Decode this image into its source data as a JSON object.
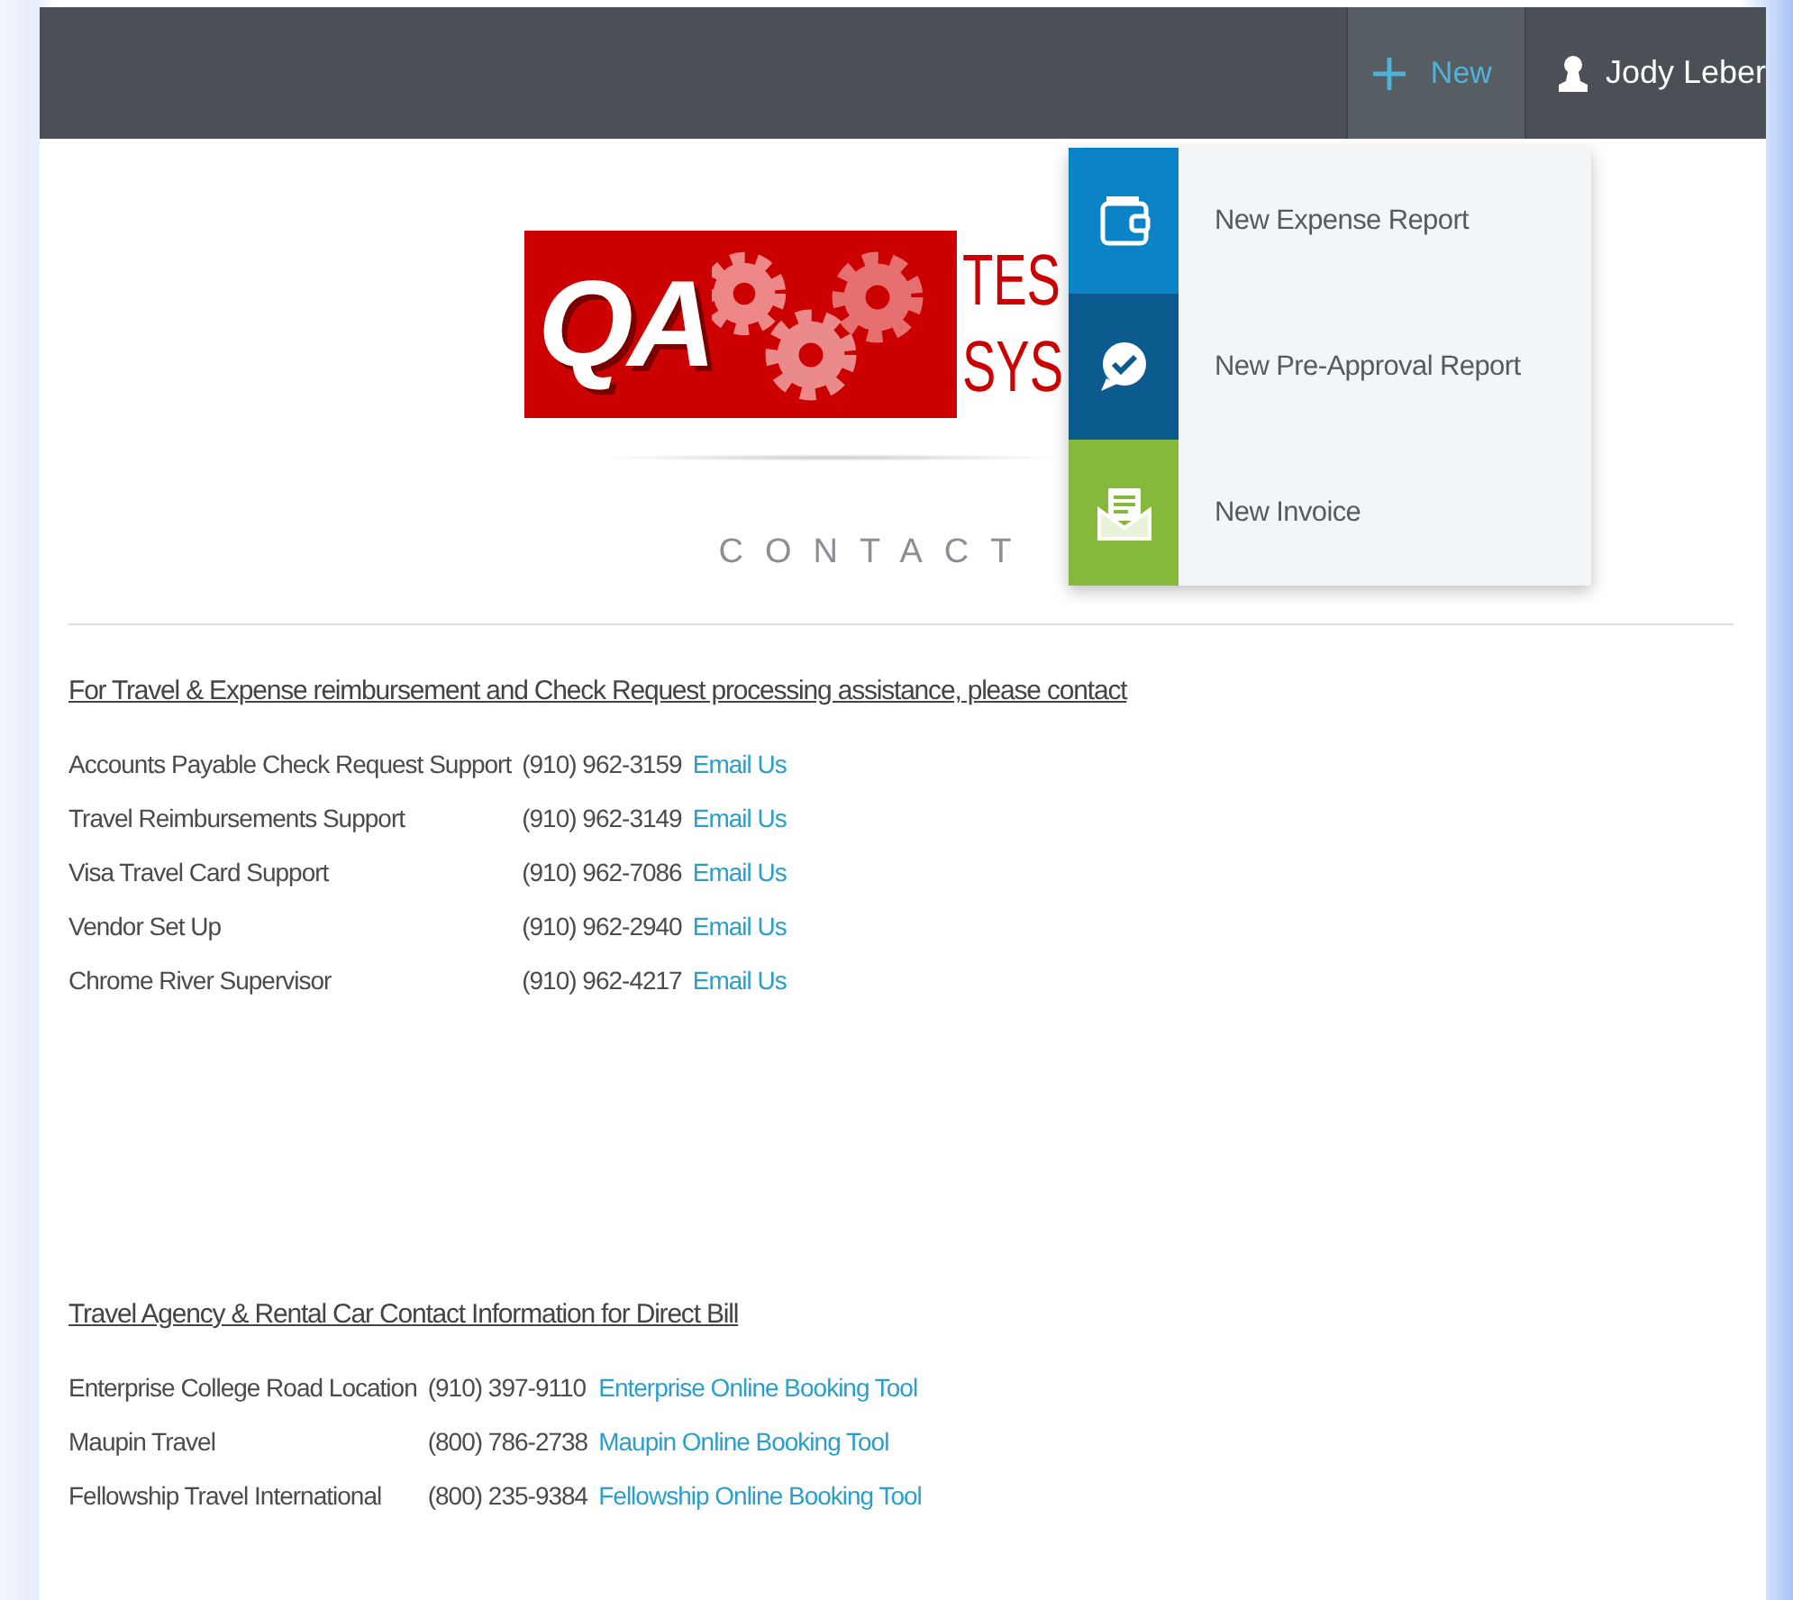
{
  "topbar": {
    "new_button": {
      "label": "New"
    },
    "user": {
      "name": "Jody Leber"
    }
  },
  "new_menu": {
    "items": [
      {
        "kind": "expense",
        "label": "New Expense Report"
      },
      {
        "kind": "preapproval",
        "label": "New Pre-Approval Report"
      },
      {
        "kind": "invoice",
        "label": "New Invoice"
      }
    ]
  },
  "logo": {
    "mark": "QA",
    "lines": [
      "TES",
      "SYS"
    ]
  },
  "page_title": "CONTACT",
  "sections": [
    {
      "heading": "For Travel & Expense reimbursement and Check Request processing assistance, please contact",
      "contacts": [
        {
          "name": "Accounts Payable Check Request Support",
          "phone": "(910) 962-3159",
          "link": "Email Us"
        },
        {
          "name": "Travel Reimbursements Support",
          "phone": "(910) 962-3149",
          "link": "Email Us"
        },
        {
          "name": "Visa Travel Card Support",
          "phone": "(910) 962-7086",
          "link": "Email Us"
        },
        {
          "name": "Vendor Set Up",
          "phone": "(910) 962-2940",
          "link": "Email Us"
        },
        {
          "name": "Chrome River Supervisor",
          "phone": "(910) 962-4217",
          "link": "Email Us"
        }
      ]
    },
    {
      "heading": "Travel Agency & Rental Car Contact Information for Direct Bill",
      "contacts": [
        {
          "name": "Enterprise College Road Location",
          "phone": "(910) 397-9110",
          "link": "Enterprise Online Booking Tool"
        },
        {
          "name": "Maupin Travel",
          "phone": "(800) 786-2738",
          "link": "Maupin Online Booking Tool"
        },
        {
          "name": "Fellowship Travel International",
          "phone": "(800) 235-9384",
          "link": "Fellowship Online Booking Tool"
        }
      ]
    }
  ]
}
